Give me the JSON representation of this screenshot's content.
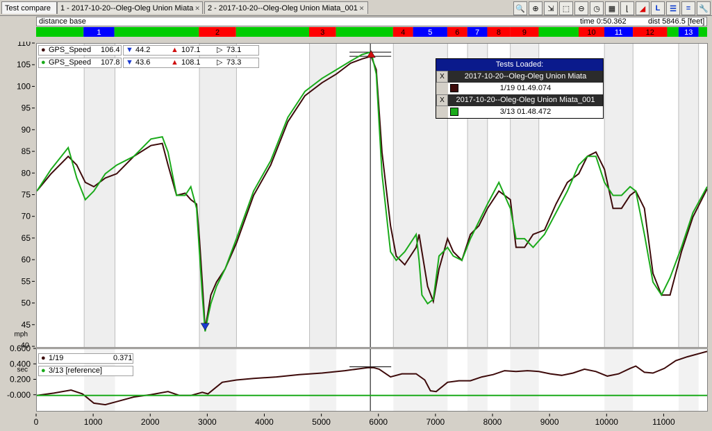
{
  "tabs": [
    {
      "label": "Test compare",
      "active": true
    },
    {
      "label": "1 - 2017-10-20--Oleg-Oleg Union Miata",
      "closable": true
    },
    {
      "label": "2 - 2017-10-20--Oleg-Oleg Union Miata_001",
      "closable": true
    }
  ],
  "toolbar": {
    "icons": [
      "zoom-2d-icon",
      "zoom-in-icon",
      "zoom-fit-icon",
      "zoom-region-icon",
      "zoom-out-icon",
      "clock-icon",
      "zoom-grid-icon",
      "corner-icon",
      "color-triangle-icon",
      "layout-l-icon",
      "layout-lines-icon",
      "layout-list-icon",
      "wrench-icon"
    ]
  },
  "header": {
    "base_label": "distance base",
    "time_label": "time 0:50.362",
    "dist_label": "dist 5846.5 [feet]"
  },
  "segments": {
    "items": [
      {
        "label": "",
        "color": "#00cc00",
        "from": 0,
        "to": 830
      },
      {
        "label": "1",
        "color": "#0000ff",
        "from": 830,
        "to": 1370
      },
      {
        "label": "",
        "color": "#00cc00",
        "from": 1370,
        "to": 2850
      },
      {
        "label": "2",
        "color": "#ff0000",
        "from": 2850,
        "to": 3500
      },
      {
        "label": "",
        "color": "#00cc00",
        "from": 3500,
        "to": 4780
      },
      {
        "label": "3",
        "color": "#ff0000",
        "from": 4780,
        "to": 5250
      },
      {
        "label": "",
        "color": "#00cc00",
        "from": 5250,
        "to": 6250
      },
      {
        "label": "4",
        "color": "#ff0000",
        "from": 6250,
        "to": 6600
      },
      {
        "label": "5",
        "color": "#0000ff",
        "from": 6600,
        "to": 7200
      },
      {
        "label": "6",
        "color": "#ff0000",
        "from": 7200,
        "to": 7550
      },
      {
        "label": "7",
        "color": "#0000ff",
        "from": 7550,
        "to": 7900
      },
      {
        "label": "8",
        "color": "#ff0000",
        "from": 7900,
        "to": 8300
      },
      {
        "label": "9",
        "color": "#ff0000",
        "from": 8300,
        "to": 8800
      },
      {
        "label": "",
        "color": "#00cc00",
        "from": 8800,
        "to": 9500
      },
      {
        "label": "10",
        "color": "#ff0000",
        "from": 9500,
        "to": 9950
      },
      {
        "label": "11",
        "color": "#0000ff",
        "from": 9950,
        "to": 10450
      },
      {
        "label": "12",
        "color": "#ff0000",
        "from": 10450,
        "to": 11050
      },
      {
        "label": "",
        "color": "#00cc00",
        "from": 11050,
        "to": 11250
      },
      {
        "label": "13",
        "color": "#0000ff",
        "from": 11250,
        "to": 11600
      },
      {
        "label": "",
        "color": "#00cc00",
        "from": 11600,
        "to": 11750
      }
    ]
  },
  "speed_legend": [
    {
      "name": "GPS_Speed",
      "value": "106.4",
      "min": "44.2",
      "max": "107.1",
      "cur": "73.1",
      "color": "#3d0a0a"
    },
    {
      "name": "GPS_Speed",
      "value": "107.8",
      "min": "43.6",
      "max": "108.1",
      "cur": "73.3",
      "color": "#1aaa1a"
    }
  ],
  "time_legend": [
    {
      "name": "1/19",
      "value": "0.371",
      "color": "#3d0a0a"
    },
    {
      "name": "3/13 [reference]",
      "value": "",
      "color": "#1aaa1a"
    }
  ],
  "tests_panel": {
    "title": "Tests Loaded:",
    "close_label": "X",
    "tests": [
      {
        "name": "2017-10-20--Oleg-Oleg Union Miata",
        "lap": "1/19 01.49.074",
        "color": "#3d0a0a"
      },
      {
        "name": "2017-10-20--Oleg-Oleg Union Miata_001",
        "lap": "3/13 01.48.472",
        "color": "#1aaa1a"
      }
    ]
  },
  "chart_data": [
    {
      "type": "line",
      "ylabel": "mph",
      "ylim": [
        40,
        110
      ],
      "xlim": [
        0,
        11750
      ],
      "yticks": [
        40,
        45,
        50,
        55,
        60,
        65,
        70,
        75,
        80,
        85,
        90,
        95,
        100,
        105,
        110
      ],
      "cursor_x": 5846.5,
      "shaded_bands": [
        [
          830,
          1370
        ],
        [
          2850,
          3500
        ],
        [
          4780,
          5250
        ],
        [
          6250,
          7200
        ],
        [
          7550,
          7900
        ],
        [
          8300,
          8800
        ],
        [
          9950,
          10450
        ],
        [
          11250,
          11600
        ]
      ],
      "extra_gridlines": [
        1000,
        2000,
        3000,
        4000,
        5000,
        6000,
        7000,
        8000,
        9000,
        10000,
        11000
      ],
      "series": [
        {
          "name": "GPS_Speed",
          "color": "#3d0a0a",
          "x": [
            0,
            250,
            550,
            700,
            850,
            1000,
            1200,
            1400,
            1700,
            2000,
            2200,
            2300,
            2450,
            2600,
            2700,
            2800,
            2850,
            2900,
            2950,
            3000,
            3050,
            3150,
            3300,
            3500,
            3800,
            4100,
            4400,
            4700,
            5000,
            5250,
            5500,
            5700,
            5860,
            5950,
            6050,
            6200,
            6300,
            6450,
            6650,
            6700,
            6750,
            6850,
            6950,
            7050,
            7200,
            7300,
            7450,
            7600,
            7750,
            7900,
            8100,
            8300,
            8400,
            8550,
            8700,
            8900,
            9100,
            9300,
            9500,
            9650,
            9800,
            9950,
            10100,
            10250,
            10400,
            10500,
            10650,
            10800,
            10950,
            11100,
            11300,
            11500,
            11750
          ],
          "y": [
            76,
            80,
            84,
            82,
            78,
            77,
            79,
            80,
            84,
            86.5,
            87,
            82,
            75,
            75.5,
            74,
            73,
            65,
            55,
            44.2,
            48,
            52,
            55,
            58,
            64,
            75,
            82,
            92,
            98,
            101,
            103,
            105.5,
            106.5,
            107.1,
            104,
            85,
            68,
            61,
            59,
            63,
            66,
            62,
            54,
            50.5,
            58,
            65,
            62,
            60,
            66,
            68,
            72,
            76,
            74,
            63,
            63,
            66,
            67,
            73,
            78,
            80,
            84,
            85,
            81,
            72,
            72,
            75,
            76,
            72,
            57,
            52,
            52,
            62,
            70,
            76.5
          ]
        },
        {
          "name": "GPS_Speed",
          "color": "#1aaa1a",
          "x": [
            0,
            250,
            550,
            700,
            850,
            1000,
            1200,
            1400,
            1700,
            2000,
            2200,
            2300,
            2450,
            2600,
            2700,
            2800,
            2850,
            2900,
            2950,
            3000,
            3050,
            3150,
            3300,
            3500,
            3800,
            4100,
            4400,
            4700,
            5000,
            5250,
            5500,
            5700,
            5860,
            5950,
            6050,
            6200,
            6300,
            6450,
            6650,
            6700,
            6750,
            6850,
            6950,
            7050,
            7200,
            7300,
            7450,
            7600,
            7750,
            7900,
            8100,
            8300,
            8400,
            8550,
            8700,
            8900,
            9100,
            9300,
            9500,
            9650,
            9800,
            9950,
            10100,
            10250,
            10400,
            10500,
            10650,
            10800,
            10950,
            11100,
            11300,
            11500,
            11750
          ],
          "y": [
            76,
            81,
            86,
            79,
            74,
            76,
            80,
            82,
            84,
            88,
            88.5,
            85,
            75,
            75,
            77,
            72,
            62,
            52,
            43.6,
            47,
            50,
            54,
            58,
            65,
            76,
            83,
            93,
            99,
            102,
            104,
            106,
            107.5,
            108.1,
            103,
            80,
            62,
            60,
            62,
            66,
            60,
            52,
            50,
            51,
            61,
            63,
            61,
            60,
            65,
            69,
            73,
            78,
            72,
            65,
            65,
            63,
            66,
            71,
            76,
            82,
            84,
            84,
            78,
            75,
            75,
            77,
            76,
            66,
            55,
            52,
            56,
            63,
            71,
            77
          ]
        }
      ]
    },
    {
      "type": "line",
      "ylabel": "sec",
      "ylim": [
        -0.2,
        0.6
      ],
      "xlim": [
        0,
        11750
      ],
      "yticks": [
        -0.0,
        0.2,
        0.4,
        0.6
      ],
      "ytick_labels": [
        "-0.000",
        "0.200",
        "0.400",
        "0.600"
      ],
      "xticks": [
        0,
        1000,
        2000,
        3000,
        4000,
        5000,
        6000,
        7000,
        8000,
        9000,
        10000,
        11000
      ],
      "series": [
        {
          "name": "1/19",
          "color": "#3d0a0a",
          "x": [
            0,
            300,
            600,
            800,
            1000,
            1200,
            1400,
            1700,
            2000,
            2300,
            2500,
            2700,
            2900,
            3000,
            3100,
            3250,
            3500,
            3800,
            4200,
            4600,
            5000,
            5400,
            5800,
            5900,
            6000,
            6200,
            6400,
            6650,
            6800,
            6900,
            7000,
            7200,
            7400,
            7600,
            7800,
            8000,
            8200,
            8400,
            8600,
            8800,
            9000,
            9200,
            9400,
            9600,
            9800,
            10000,
            10200,
            10400,
            10500,
            10650,
            10800,
            11000,
            11200,
            11400,
            11750
          ],
          "y": [
            0.0,
            0.03,
            0.07,
            0.02,
            -0.1,
            -0.12,
            -0.08,
            -0.02,
            0.01,
            0.05,
            0.0,
            0.0,
            0.04,
            0.02,
            0.08,
            0.17,
            0.2,
            0.22,
            0.24,
            0.27,
            0.29,
            0.32,
            0.36,
            0.36,
            0.34,
            0.24,
            0.28,
            0.28,
            0.2,
            0.06,
            0.05,
            0.17,
            0.19,
            0.19,
            0.24,
            0.27,
            0.32,
            0.31,
            0.32,
            0.31,
            0.28,
            0.26,
            0.29,
            0.34,
            0.31,
            0.25,
            0.28,
            0.35,
            0.38,
            0.3,
            0.29,
            0.35,
            0.45,
            0.5,
            0.57
          ]
        },
        {
          "name": "3/13 [reference]",
          "color": "#1aaa1a",
          "x": [
            0,
            11750
          ],
          "y": [
            0.0,
            0.0
          ]
        }
      ]
    }
  ]
}
